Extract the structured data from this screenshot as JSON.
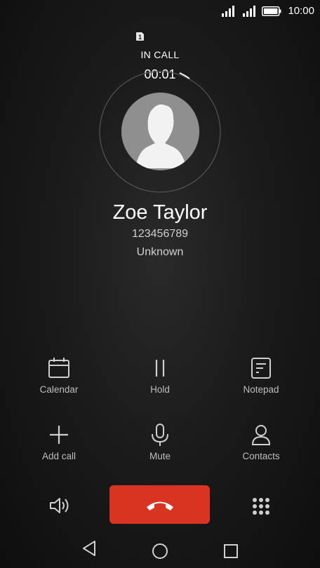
{
  "status_bar": {
    "time": "10:00",
    "icons": [
      "signal-icon",
      "signal-icon",
      "battery-icon"
    ]
  },
  "call": {
    "sim_label": "1",
    "state": "IN CALL",
    "timer": "00:01",
    "name": "Zoe Taylor",
    "number": "123456789",
    "location": "Unknown"
  },
  "actions": [
    {
      "label": "Calendar",
      "icon": "calendar-icon"
    },
    {
      "label": "Hold",
      "icon": "pause-icon"
    },
    {
      "label": "Notepad",
      "icon": "notepad-icon"
    },
    {
      "label": "Add call",
      "icon": "plus-icon"
    },
    {
      "label": "Mute",
      "icon": "microphone-icon"
    },
    {
      "label": "Contacts",
      "icon": "person-icon"
    }
  ],
  "bottom": {
    "speaker": "speaker-icon",
    "end_call": "end-call-icon",
    "dialpad": "dialpad-icon"
  },
  "nav": [
    "back-icon",
    "home-icon",
    "recents-icon"
  ],
  "colors": {
    "end_call": "#d93422",
    "background": "#1b1b1b"
  }
}
